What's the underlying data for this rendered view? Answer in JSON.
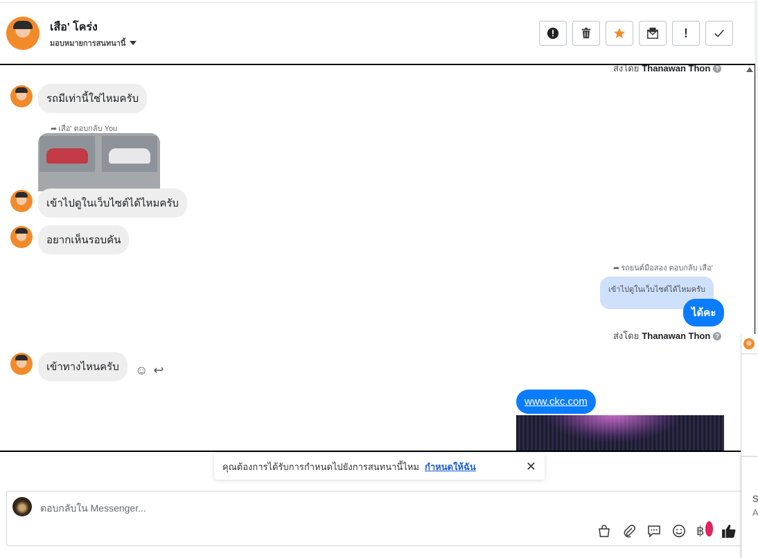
{
  "header": {
    "name": "เสือ' โคร่ง",
    "assign_label": "มอบหมายการสนทนานี้"
  },
  "toolbar": {
    "buttons": [
      "alert-circle-icon",
      "trash-icon",
      "star-icon",
      "mark-unread-icon",
      "important-icon",
      "check-icon"
    ],
    "star_color": "#f28a2a"
  },
  "thread": {
    "top_sent_by_prefix": "ส่งโดย",
    "top_sent_by_name": "Thanawan Thon",
    "msg1": "รถมีเท่านี้ใช่ไหมครับ",
    "reply_meta": "เสือ' ตอบกลับ You",
    "msg2": "เข้าไปดูในเว็บไซต์ได้ไหมครับ",
    "msg3": "อยากเห็นรอบคัน",
    "out_reply_meta": "รถยนต์มือสอง ตอบกลับ เสือ'",
    "out_quoted": "เข้าไปดูในเว็บไซต์ได้ไหมครับ",
    "out_msg": "ได้คะ",
    "sent_by_prefix": "ส่งโดย",
    "sent_by_name": "Thanawan Thon",
    "msg4": "เข้าทางไหนครับ",
    "link_msg": "www.ckc.com"
  },
  "assign_banner": {
    "text": "คุณต้องการได้รับการกำหนดไปยังการสนทนานี้ไหม",
    "link": "กำหนดให้ฉัน"
  },
  "composer": {
    "placeholder": "ตอบกลับใน Messenger...",
    "tools": [
      "shopping-bag-icon",
      "paperclip-icon",
      "saved-reply-icon",
      "emoji-icon",
      "payment-icon",
      "like-icon"
    ]
  },
  "side_panel": {
    "line1": "Se",
    "line2": "A"
  },
  "colors": {
    "outgoing_bubble": "#0a7cff",
    "incoming_bubble": "#eeeeee",
    "quoted_bubble": "#cfe0fb",
    "link": "#1a5cd6"
  }
}
